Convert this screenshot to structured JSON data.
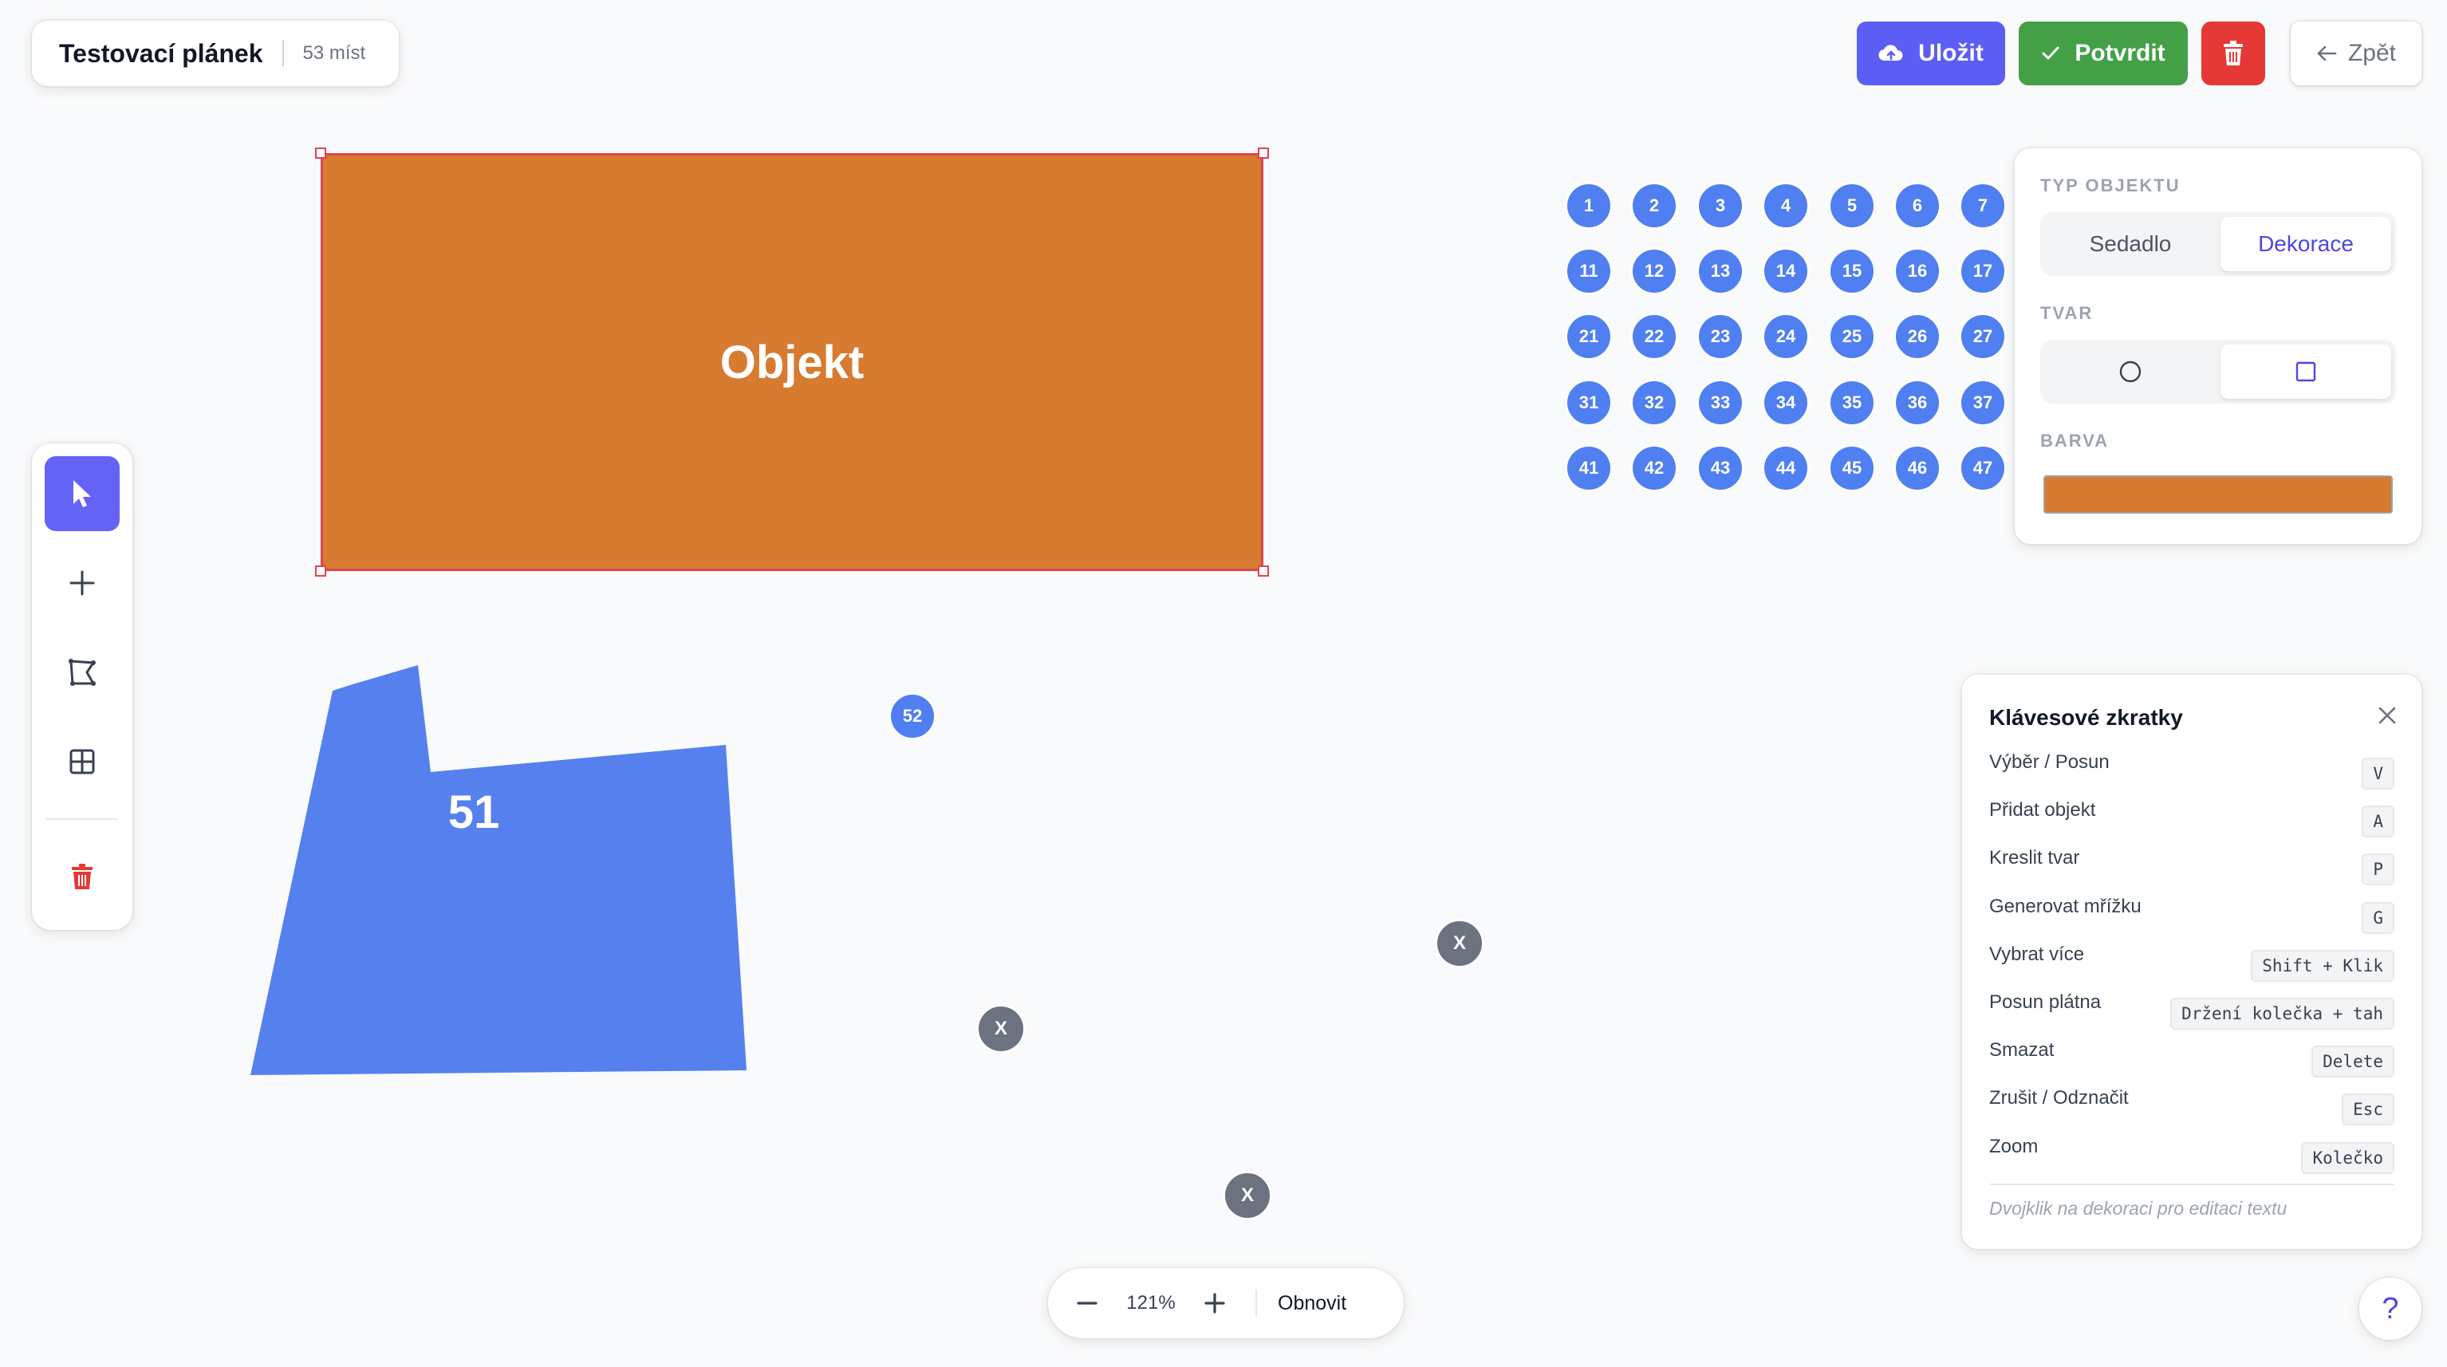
{
  "header": {
    "title": "Testovací plánek",
    "seat_count": "53 míst"
  },
  "actions": {
    "save_label": "Uložit",
    "confirm_label": "Potvrdit",
    "back_label": "Zpět"
  },
  "toolbar": {
    "tools": [
      "select-tool",
      "add-object-tool",
      "draw-shape-tool",
      "grid-tool",
      "delete-tool"
    ],
    "active_tool": "select-tool"
  },
  "canvas": {
    "selected_object": {
      "label": "Objekt",
      "color": "#d67b30"
    },
    "polygon": {
      "label": "51",
      "color": "#5580ee"
    },
    "seat_grid": [
      [
        "1",
        "2",
        "3",
        "4",
        "5",
        "6",
        "7"
      ],
      [
        "11",
        "12",
        "13",
        "14",
        "15",
        "16",
        "17"
      ],
      [
        "21",
        "22",
        "23",
        "24",
        "25",
        "26",
        "27"
      ],
      [
        "31",
        "32",
        "33",
        "34",
        "35",
        "36",
        "37"
      ],
      [
        "41",
        "42",
        "43",
        "44",
        "45",
        "46",
        "47"
      ]
    ],
    "single_seat": "52",
    "x_markers": [
      "X",
      "X",
      "X"
    ],
    "seat_color": "#4f7ff0",
    "marker_color": "#6b7280"
  },
  "properties": {
    "type_heading": "TYP OBJEKTU",
    "type_options": [
      "Sedadlo",
      "Dekorace"
    ],
    "type_selected": "Dekorace",
    "shape_heading": "TVAR",
    "shape_options": [
      "circle-icon",
      "square-icon"
    ],
    "shape_selected": "square-icon",
    "color_heading": "BARVA",
    "color_value": "#d67b30"
  },
  "shortcuts": {
    "title": "Klávesové zkratky",
    "items": [
      {
        "label": "Výběr / Posun",
        "key": "V"
      },
      {
        "label": "Přidat objekt",
        "key": "A"
      },
      {
        "label": "Kreslit tvar",
        "key": "P"
      },
      {
        "label": "Generovat mřížku",
        "key": "G"
      },
      {
        "label": "Vybrat více",
        "key": "Shift + Klik"
      },
      {
        "label": "Posun plátna",
        "key": "Držení kolečka + tah"
      },
      {
        "label": "Smazat",
        "key": "Delete"
      },
      {
        "label": "Zrušit / Odznačit",
        "key": "Esc"
      },
      {
        "label": "Zoom",
        "key": "Kolečko"
      }
    ],
    "hint": "Dvojklik na dekoraci pro editaci textu"
  },
  "zoom": {
    "level": "121%",
    "reset_label": "Obnovit"
  },
  "help": {
    "label": "?"
  }
}
